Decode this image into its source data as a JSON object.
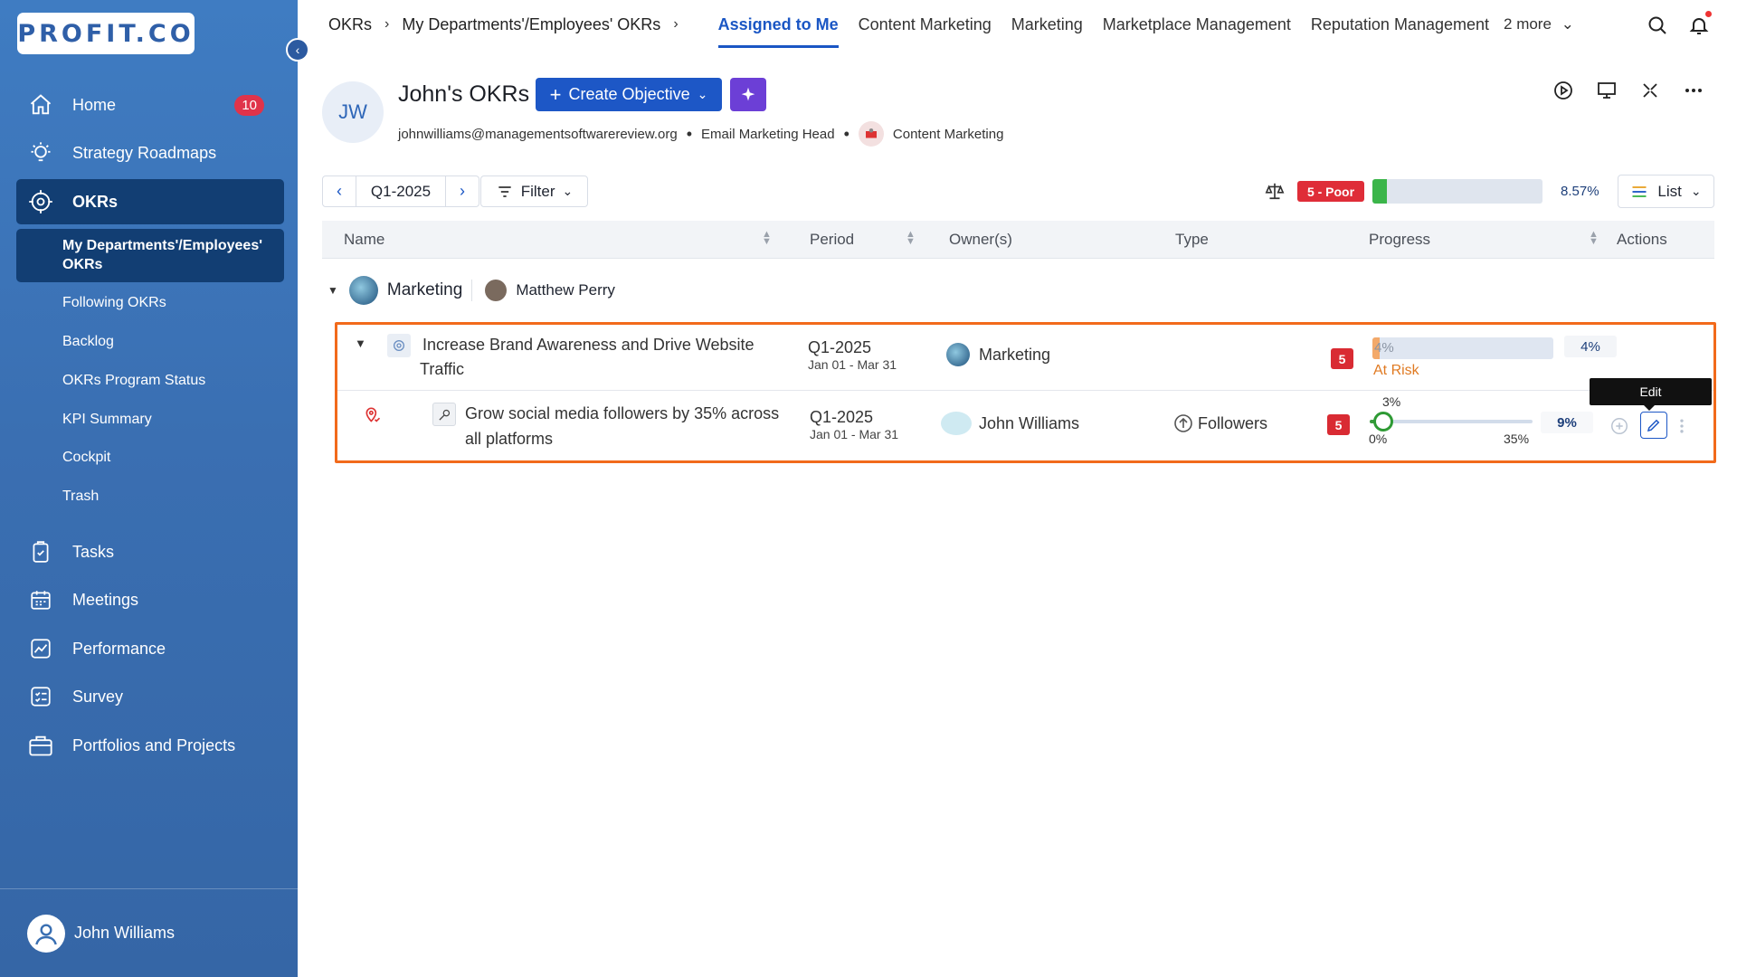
{
  "brand": {
    "logo_text": "PROFIT.CO"
  },
  "sidebar": {
    "home": {
      "label": "Home",
      "badge": "10"
    },
    "strategy": {
      "label": "Strategy Roadmaps"
    },
    "okrs": {
      "label": "OKRs"
    },
    "sub_items": [
      {
        "label": "My Departments'/Employees' OKRs",
        "active": true
      },
      {
        "label": "Following OKRs"
      },
      {
        "label": "Backlog"
      },
      {
        "label": "OKRs Program Status"
      },
      {
        "label": "KPI Summary"
      },
      {
        "label": "Cockpit"
      },
      {
        "label": "Trash"
      }
    ],
    "tasks": {
      "label": "Tasks"
    },
    "meetings": {
      "label": "Meetings"
    },
    "performance": {
      "label": "Performance"
    },
    "survey": {
      "label": "Survey"
    },
    "portfolios": {
      "label": "Portfolios and Projects"
    },
    "user": {
      "name": "John Williams"
    }
  },
  "topnav": {
    "crumb_root": "OKRs",
    "crumb_current": "My Departments'/Employees' OKRs",
    "tabs": [
      {
        "label": "Assigned to Me",
        "active": true
      },
      {
        "label": "Content Marketing"
      },
      {
        "label": "Marketing"
      },
      {
        "label": "Marketplace Management"
      },
      {
        "label": "Reputation Management"
      }
    ],
    "more_label": "2 more"
  },
  "header": {
    "initials": "JW",
    "title": "John's OKRs",
    "create_label": "Create Objective",
    "email": "johnwilliams@managementsoftwarereview.org",
    "role": "Email Marketing Head",
    "department": "Content Marketing"
  },
  "controls": {
    "period": "Q1-2025",
    "filter_label": "Filter",
    "score_badge": "5 - Poor",
    "overall_progress": 8.57,
    "overall_pct_label": "8.57%",
    "view_label": "List"
  },
  "table": {
    "headers": {
      "name": "Name",
      "period": "Period",
      "owners": "Owner(s)",
      "type": "Type",
      "progress": "Progress",
      "actions": "Actions"
    },
    "group": {
      "name": "Marketing",
      "owner": "Matthew Perry"
    },
    "objective": {
      "name_line1": "Increase Brand Awareness and Drive Website",
      "name_line2": "Traffic",
      "period": "Q1-2025",
      "dates": "Jan 01 - Mar 31",
      "owner": "Marketing",
      "score": "5",
      "progress": 4,
      "progress_label": "4%",
      "pct_label": "4%",
      "status": "At Risk"
    },
    "key_result": {
      "name_line1": "Grow social media followers by 35% across",
      "name_line2": "all platforms",
      "period": "Q1-2025",
      "dates": "Jan 01 - Mar 31",
      "owner": "John Williams",
      "type": "Followers",
      "score": "5",
      "current_label": "3%",
      "min_label": "0%",
      "max_label": "35%",
      "current_value": 3,
      "target_value": 35,
      "pct_label": "9%",
      "tooltip": "Edit"
    }
  },
  "colors": {
    "accent": "#1d57c6",
    "sidebar": "#3a6fb2",
    "danger": "#df2d38",
    "highlight": "#f26a1b"
  }
}
